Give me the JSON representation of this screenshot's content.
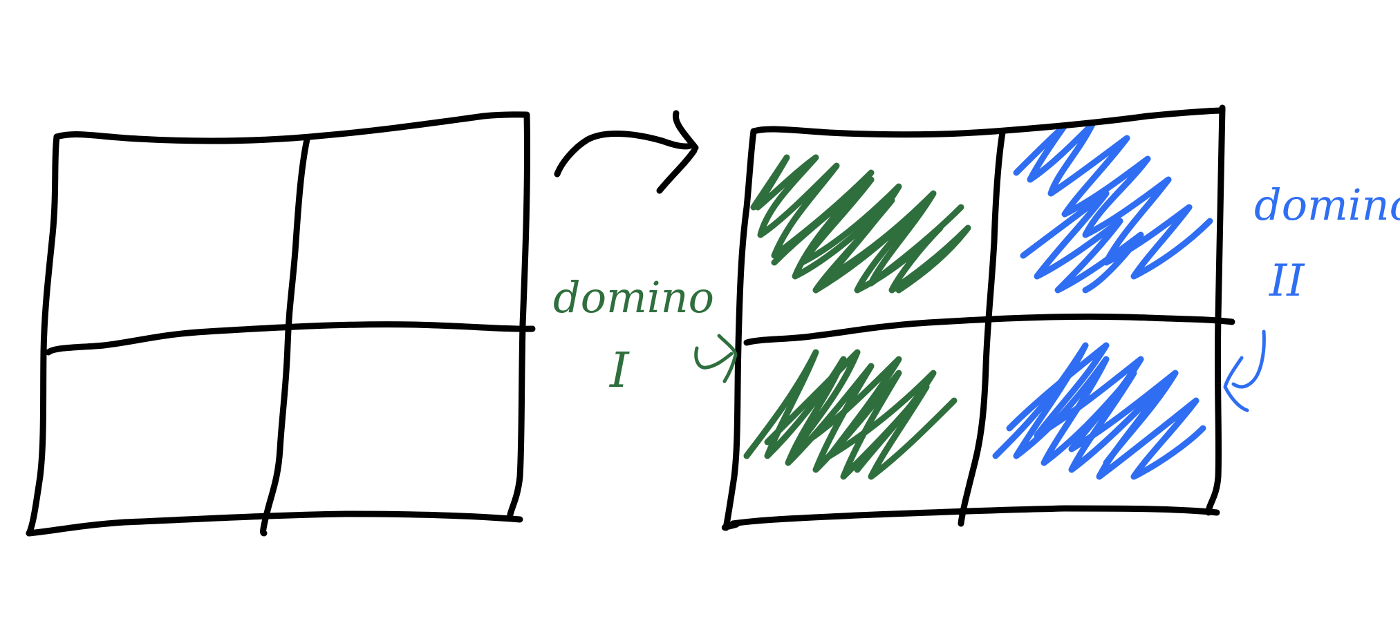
{
  "colors": {
    "ink": "#000000",
    "domain_one": "#2f6f3e",
    "domain_two": "#2f6ef2",
    "background": "#ffffff"
  },
  "labels": {
    "domain_one_word": "domino",
    "domain_one_numeral": "I",
    "domain_two_word": "domino",
    "domain_two_numeral": "II"
  },
  "grids": {
    "left": {
      "rows": 2,
      "cols": 2,
      "filled": false
    },
    "right": {
      "rows": 2,
      "cols": 2,
      "filled": true,
      "cells": [
        {
          "row": 0,
          "col": 0,
          "fill": "domain_one"
        },
        {
          "row": 1,
          "col": 0,
          "fill": "domain_one"
        },
        {
          "row": 0,
          "col": 1,
          "fill": "domain_two"
        },
        {
          "row": 1,
          "col": 1,
          "fill": "domain_two"
        }
      ]
    }
  },
  "icons": {
    "transition_arrow": "curved-arrow-icon",
    "domain_one_pointer": "curved-arrow-icon",
    "domain_two_pointer": "bracket-arrow-icon"
  }
}
